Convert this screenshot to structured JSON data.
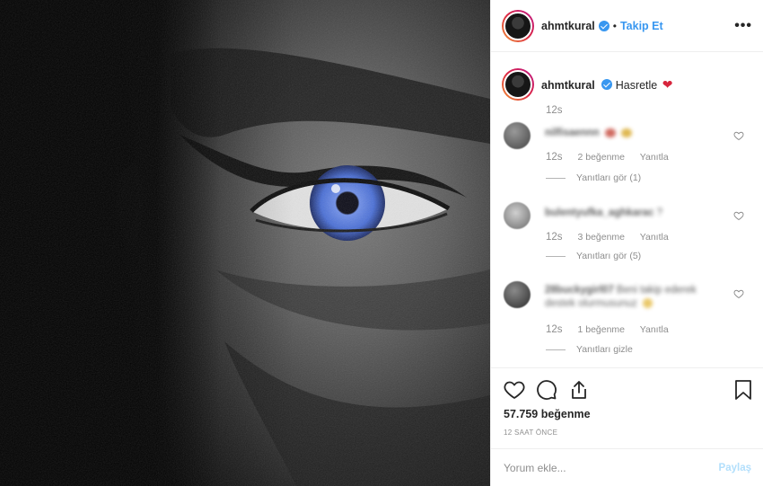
{
  "header": {
    "username": "ahmtkural",
    "separator": "•",
    "follow_label": "Takip Et",
    "more_label": "•••"
  },
  "caption": {
    "username": "ahmtkural",
    "text": "Hasretle",
    "emoji": "❤",
    "time": "12s"
  },
  "comments": [
    {
      "username": "nilfisaennn",
      "text": "",
      "time": "12s",
      "likes": "2 beğenme",
      "reply_label": "Yanıtla",
      "replies_label": "Yanıtları gör (1)",
      "emoji_colors": [
        "#c0392b",
        "#d4a017"
      ]
    },
    {
      "username": "bulentyufka_aghkarac",
      "text": "?",
      "time": "12s",
      "likes": "3 beğenme",
      "reply_label": "Yanıtla",
      "replies_label": "Yanıtları gör (5)",
      "emoji_colors": []
    },
    {
      "username": "28buckygirl07",
      "text": "Beni takip ederek",
      "text2": "destek olurmusunuz",
      "time": "12s",
      "likes": "1 beğenme",
      "reply_label": "Yanıtla",
      "replies_label": "Yanıtları gizle",
      "emoji_colors": [
        "#e1b12c"
      ]
    }
  ],
  "actions": {
    "icons": [
      "heart-outline-icon",
      "comment-bubble-icon",
      "share-icon",
      "bookmark-icon"
    ],
    "likes_total": "57.759 beğenme",
    "posted_ago": "12 SAAT ÖNCE"
  },
  "composer": {
    "placeholder": "Yorum ekle...",
    "post_label": "Paylaş"
  },
  "colors": {
    "accent": "#3897f0",
    "heart": "#d7263d",
    "muted": "#8e8e8e",
    "iris": "#4a6fd6"
  }
}
